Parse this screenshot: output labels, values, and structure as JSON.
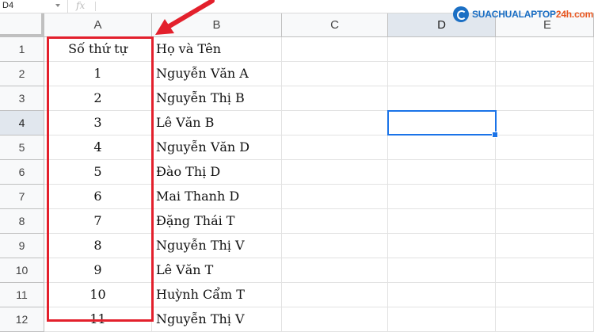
{
  "formula_bar": {
    "name_box": "D4",
    "fx_label": "fx"
  },
  "columns": [
    "A",
    "B",
    "C",
    "D",
    "E"
  ],
  "rows": [
    {
      "num": "1",
      "a": "Số thứ tự",
      "b": "Họ và Tên"
    },
    {
      "num": "2",
      "a": "1",
      "b": "Nguyễn Văn A"
    },
    {
      "num": "3",
      "a": "2",
      "b": "Nguyễn Thị B"
    },
    {
      "num": "4",
      "a": "3",
      "b": "Lê Văn B"
    },
    {
      "num": "5",
      "a": "4",
      "b": "Nguyễn Văn D"
    },
    {
      "num": "6",
      "a": "5",
      "b": "Đào Thị D"
    },
    {
      "num": "7",
      "a": "6",
      "b": "Mai Thanh D"
    },
    {
      "num": "8",
      "a": "7",
      "b": "Đặng Thái T"
    },
    {
      "num": "9",
      "a": "8",
      "b": "Nguyễn Thị V"
    },
    {
      "num": "10",
      "a": "9",
      "b": "Lê Văn T"
    },
    {
      "num": "11",
      "a": "10",
      "b": "Huỳnh Cẩm T"
    },
    {
      "num": "12",
      "a": "11",
      "b": "Nguyễn Thị V"
    }
  ],
  "selected_cell": "D4",
  "logo": {
    "text_main": "SUACHUALAPTOP",
    "text_accent": "24h.com"
  },
  "colors": {
    "highlight_red": "#e3202c",
    "selection_blue": "#1a73e8",
    "header_bg": "#f8f9fa"
  }
}
